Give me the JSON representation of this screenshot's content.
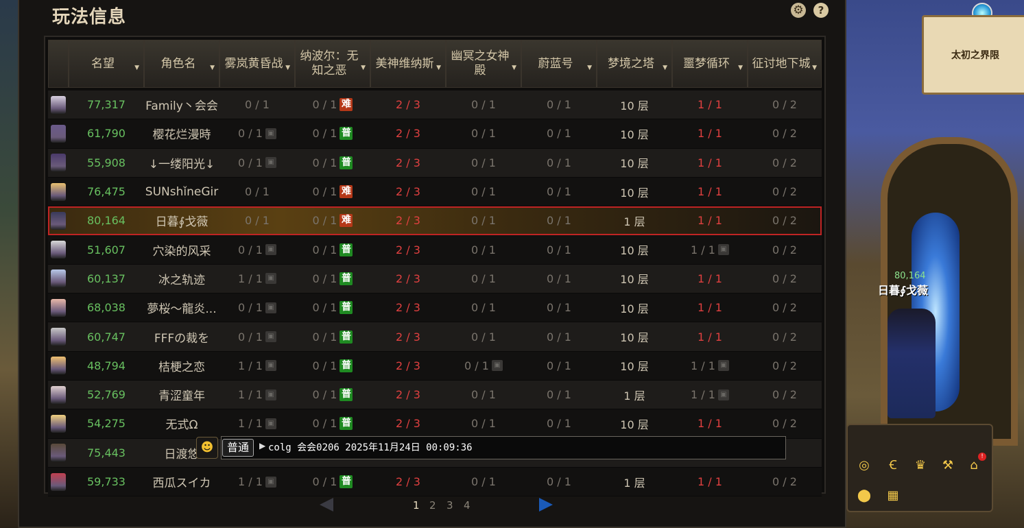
{
  "window": {
    "title": "玩法信息"
  },
  "columns": [
    {
      "label": "",
      "sortable": false
    },
    {
      "label": "名望",
      "sortable": true
    },
    {
      "label": "角色名",
      "sortable": true
    },
    {
      "label": "雾岚黄昏战",
      "sortable": true
    },
    {
      "label": "纳波尔：无知之恶",
      "sortable": true
    },
    {
      "label": "美神维纳斯",
      "sortable": true
    },
    {
      "label": "幽冥之女神殿",
      "sortable": true
    },
    {
      "label": "蔚蓝号",
      "sortable": true
    },
    {
      "label": "梦境之塔",
      "sortable": true
    },
    {
      "label": "噩梦循环",
      "sortable": true
    },
    {
      "label": "征讨地下城",
      "sortable": true
    }
  ],
  "rows": [
    {
      "fame": "77,317",
      "name": "Family丶会会",
      "c1": "0 / 1",
      "c1_lock": false,
      "c2": "0 / 1",
      "c2_tag": "难",
      "c3": "2 / 3",
      "c4": "0 / 1",
      "c4_lock": false,
      "c5": "0 / 1",
      "c6": "10 层",
      "c7": "1 / 1",
      "c7_lock": false,
      "c8": "0 / 2"
    },
    {
      "fame": "61,790",
      "name": "樱花烂漫時",
      "c1": "0 / 1",
      "c1_lock": true,
      "c2": "0 / 1",
      "c2_tag": "普",
      "c3": "2 / 3",
      "c4": "0 / 1",
      "c4_lock": false,
      "c5": "0 / 1",
      "c6": "10 层",
      "c7": "1 / 1",
      "c7_lock": false,
      "c8": "0 / 2"
    },
    {
      "fame": "55,908",
      "name": "↓一缕阳光↓",
      "c1": "0 / 1",
      "c1_lock": true,
      "c2": "0 / 1",
      "c2_tag": "普",
      "c3": "2 / 3",
      "c4": "0 / 1",
      "c4_lock": false,
      "c5": "0 / 1",
      "c6": "10 层",
      "c7": "1 / 1",
      "c7_lock": false,
      "c8": "0 / 2"
    },
    {
      "fame": "76,475",
      "name": "SUNshǐneGir",
      "c1": "0 / 1",
      "c1_lock": false,
      "c2": "0 / 1",
      "c2_tag": "难",
      "c3": "2 / 3",
      "c4": "0 / 1",
      "c4_lock": false,
      "c5": "0 / 1",
      "c6": "10 层",
      "c7": "1 / 1",
      "c7_lock": false,
      "c8": "0 / 2"
    },
    {
      "fame": "80,164",
      "name": "日暮∮戈薇",
      "c1": "0 / 1",
      "c1_lock": false,
      "c2": "0 / 1",
      "c2_tag": "难",
      "c3": "2 / 3",
      "c4": "0 / 1",
      "c4_lock": false,
      "c5": "0 / 1",
      "c6": "1 层",
      "c7": "1 / 1",
      "c7_lock": false,
      "c8": "0 / 2",
      "selected": true
    },
    {
      "fame": "51,607",
      "name": "穴染的风采",
      "c1": "0 / 1",
      "c1_lock": true,
      "c2": "0 / 1",
      "c2_tag": "普",
      "c3": "2 / 3",
      "c4": "0 / 1",
      "c4_lock": false,
      "c5": "0 / 1",
      "c6": "10 层",
      "c7": "1 / 1",
      "c7_lock": true,
      "c8": "0 / 2"
    },
    {
      "fame": "60,137",
      "name": "冰之轨迹",
      "c1": "1 / 1",
      "c1_lock": true,
      "c2": "0 / 1",
      "c2_tag": "普",
      "c3": "2 / 3",
      "c4": "0 / 1",
      "c4_lock": false,
      "c5": "0 / 1",
      "c6": "10 层",
      "c7": "1 / 1",
      "c7_lock": false,
      "c8": "0 / 2"
    },
    {
      "fame": "68,038",
      "name": "夢桜～龍炎...",
      "c1": "0 / 1",
      "c1_lock": true,
      "c2": "0 / 1",
      "c2_tag": "普",
      "c3": "2 / 3",
      "c4": "0 / 1",
      "c4_lock": false,
      "c5": "0 / 1",
      "c6": "10 层",
      "c7": "1 / 1",
      "c7_lock": false,
      "c8": "0 / 2"
    },
    {
      "fame": "60,747",
      "name": "FFFの裁を",
      "c1": "0 / 1",
      "c1_lock": true,
      "c2": "0 / 1",
      "c2_tag": "普",
      "c3": "2 / 3",
      "c4": "0 / 1",
      "c4_lock": false,
      "c5": "0 / 1",
      "c6": "10 层",
      "c7": "1 / 1",
      "c7_lock": false,
      "c8": "0 / 2"
    },
    {
      "fame": "48,794",
      "name": "桔梗之恋",
      "c1": "1 / 1",
      "c1_lock": true,
      "c2": "0 / 1",
      "c2_tag": "普",
      "c3": "2 / 3",
      "c4": "0 / 1",
      "c4_lock": true,
      "c5": "0 / 1",
      "c6": "10 层",
      "c7": "1 / 1",
      "c7_lock": true,
      "c8": "0 / 2"
    },
    {
      "fame": "52,769",
      "name": "青涩童年",
      "c1": "1 / 1",
      "c1_lock": true,
      "c2": "0 / 1",
      "c2_tag": "普",
      "c3": "2 / 3",
      "c4": "0 / 1",
      "c4_lock": false,
      "c5": "0 / 1",
      "c6": "1 层",
      "c7": "1 / 1",
      "c7_lock": true,
      "c8": "0 / 2"
    },
    {
      "fame": "54,275",
      "name": "无式Ω",
      "c1": "1 / 1",
      "c1_lock": true,
      "c2": "0 / 1",
      "c2_tag": "普",
      "c3": "2 / 3",
      "c4": "0 / 1",
      "c4_lock": false,
      "c5": "0 / 1",
      "c6": "10 层",
      "c7": "1 / 1",
      "c7_lock": false,
      "c8": "0 / 2"
    },
    {
      "fame": "75,443",
      "name": "日渡悠",
      "c1": "",
      "c1_lock": false,
      "c2": "",
      "c2_tag": "",
      "c3": "",
      "c4": "",
      "c4_lock": false,
      "c5": "",
      "c6": "",
      "c7": "",
      "c7_lock": false,
      "c8": "2",
      "obscured": true
    },
    {
      "fame": "59,733",
      "name": "西瓜スイカ",
      "c1": "1 / 1",
      "c1_lock": true,
      "c2": "0 / 1",
      "c2_tag": "普",
      "c3": "2 / 3",
      "c4": "0 / 1",
      "c4_lock": false,
      "c5": "0 / 1",
      "c6": "1 层",
      "c7": "1 / 1",
      "c7_lock": false,
      "c8": "0 / 2"
    }
  ],
  "chat": {
    "channel": "普通",
    "input_value": "colg 会会0206 2025年11月24日 00:09:36"
  },
  "pagination": {
    "pages": [
      "1",
      "2",
      "3",
      "4"
    ],
    "current": "1"
  },
  "scene": {
    "location_sign": "太初之界限",
    "character_name": "日暮∮戈薇",
    "character_fame": "80,164"
  },
  "colors": {
    "fame": "#68c060",
    "red_count": "#e04040",
    "selected_border": "#c02424",
    "easy_tag": "#1f8a22",
    "hard_tag": "#b53818"
  },
  "icons": {
    "settings": "gear-icon",
    "help": "help-icon",
    "chat_emoji": "emoji-icon",
    "lock": "lock-icon"
  }
}
